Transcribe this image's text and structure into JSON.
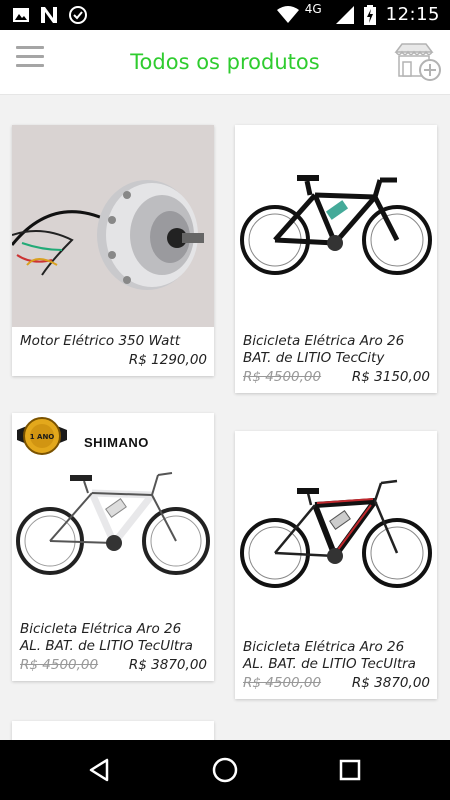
{
  "status_bar": {
    "network": "4G",
    "time": "12:15"
  },
  "app_bar": {
    "title": "Todos os produtos"
  },
  "products": [
    {
      "name": "Motor Elétrico 350 Watt",
      "old_price": "",
      "price": "R$ 1290,00"
    },
    {
      "name": "Bicicleta Elétrica Aro 26 BAT. de LITIO TecCity",
      "old_price": "R$ 4500,00",
      "price": "R$ 3150,00"
    },
    {
      "name": "Bicicleta Elétrica Aro 26 AL. BAT. de LITIO TecUltra",
      "old_price": "R$ 4500,00",
      "price": "R$ 3870,00",
      "brand_logo": "SHIMANO",
      "badge_text": "1 ANO"
    },
    {
      "name": "Bicicleta Elétrica Aro 26 AL. BAT. de LITIO TecUltra",
      "old_price": "R$ 4500,00",
      "price": "R$ 3870,00"
    }
  ],
  "icons": {
    "menu": "hamburger-menu-icon",
    "store": "store-add-icon",
    "back": "back-triangle-icon",
    "home": "home-circle-icon",
    "recents": "recents-square-icon"
  },
  "colors": {
    "accent": "#2fcc2f",
    "status_bar": "#000000",
    "nav_bar": "#000000",
    "list_bg": "#f2f2f2"
  }
}
